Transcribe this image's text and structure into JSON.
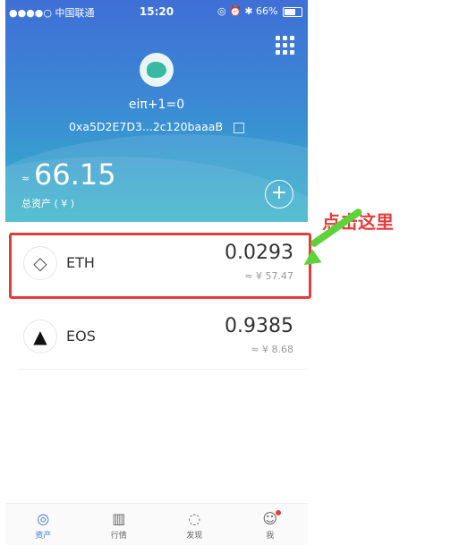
{
  "status_bar": {
    "carrier": "●●●●○ 中国联通 ",
    "time": "15:20",
    "right": "◎ ⏰ ✱ 66%"
  },
  "wallet": {
    "name": "eiπ+1=0",
    "address": "0xa5D2E7D3...2c120baaaB"
  },
  "balance": {
    "approx": "≈",
    "total": "66.15",
    "label": "总资产 ( ¥ )"
  },
  "add_icon": "+",
  "assets": [
    {
      "symbol": "ETH",
      "amount": "0.0293",
      "value": "≈ ¥ 57.47",
      "icon": "◇"
    },
    {
      "symbol": "EOS",
      "amount": "0.9385",
      "value": "≈ ¥ 8.68",
      "icon": "▲"
    }
  ],
  "annotation": {
    "text": "点击这里",
    "color": "#e23d3d",
    "arrow_color": "#5fd13b"
  },
  "tabs": [
    {
      "label": "资产",
      "icon": "◎",
      "active": true
    },
    {
      "label": "行情",
      "icon": "▥",
      "active": false
    },
    {
      "label": "发现",
      "icon": "◌",
      "active": false
    },
    {
      "label": "我",
      "icon": "☺",
      "active": false
    }
  ],
  "colors": {
    "accent": "#3b78d6",
    "header_top": "#3f6fd6",
    "header_bottom": "#34b3c9"
  }
}
